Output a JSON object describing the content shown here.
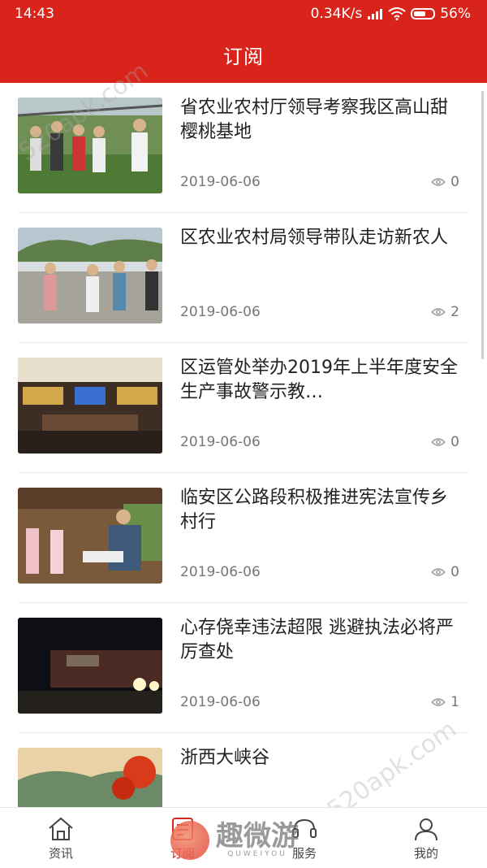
{
  "status_bar": {
    "time": "14:43",
    "network_speed": "0.34K/s",
    "battery": "56%"
  },
  "header": {
    "title": "订阅"
  },
  "articles": [
    {
      "title": "省农业农村厅领导考察我区高山甜樱桃基地",
      "date": "2019-06-06",
      "views": "0"
    },
    {
      "title": "区农业农村局领导带队走访新农人",
      "date": "2019-06-06",
      "views": "2"
    },
    {
      "title": "区运管处举办2019年上半年度安全生产事故警示教…",
      "date": "2019-06-06",
      "views": "0"
    },
    {
      "title": "临安区公路段积极推进宪法宣传乡村行",
      "date": "2019-06-06",
      "views": "0"
    },
    {
      "title": "心存侥幸违法超限 逃避执法必将严厉查处",
      "date": "2019-06-06",
      "views": "1"
    },
    {
      "title": "浙西大峡谷",
      "date": "",
      "views": ""
    }
  ],
  "tabs": [
    {
      "label": "资讯",
      "icon": "home-icon"
    },
    {
      "label": "订阅",
      "icon": "subscribe-icon"
    },
    {
      "label": "服务",
      "icon": "service-icon"
    },
    {
      "label": "我的",
      "icon": "profile-icon"
    }
  ],
  "watermarks": {
    "top": "520apk.com",
    "bottom": "520apk.com",
    "logo_text": "趣微游",
    "logo_sub": "QUWEIYOU"
  },
  "colors": {
    "accent": "#d9241c"
  }
}
